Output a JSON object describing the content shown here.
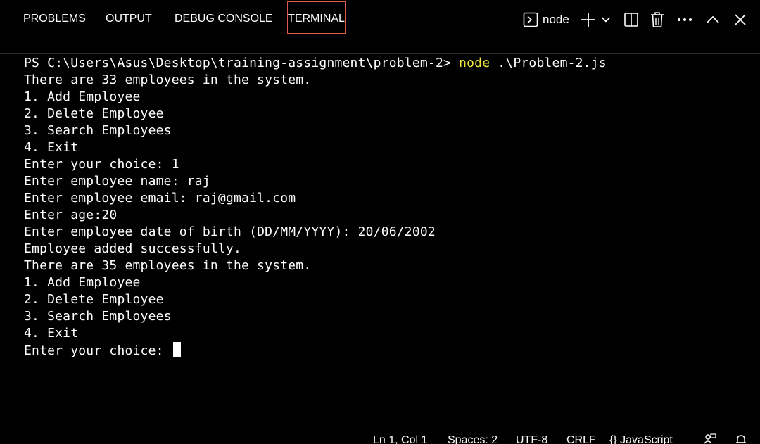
{
  "tabs": [
    {
      "label": "PROBLEMS"
    },
    {
      "label": "OUTPUT"
    },
    {
      "label": "DEBUG CONSOLE"
    },
    {
      "label": "TERMINAL"
    }
  ],
  "active_tab": "TERMINAL",
  "terminal_toolbar": {
    "terminal_name": "node",
    "icons": [
      "terminal-icon",
      "plus-icon",
      "chevron-down-icon",
      "split-icon",
      "trash-icon",
      "more-icon",
      "chevron-up-icon",
      "close-icon"
    ]
  },
  "terminal": {
    "prompt": "PS C:\\Users\\Asus\\Desktop\\training-assignment\\problem-2> ",
    "command": "node",
    "command_args": " .\\Problem-2.js",
    "lines": [
      "There are 33 employees in the system.",
      "1. Add Employee",
      "2. Delete Employee",
      "3. Search Employees",
      "4. Exit",
      "Enter your choice: 1",
      "Enter employee name: raj",
      "Enter employee email: raj@gmail.com",
      "Enter age:20",
      "Enter employee date of birth (DD/MM/YYYY): 20/06/2002",
      "Employee added successfully.",
      "There are 35 employees in the system.",
      "1. Add Employee",
      "2. Delete Employee",
      "3. Search Employees",
      "4. Exit"
    ],
    "current_input_prompt": "Enter your choice: "
  },
  "statusbar": {
    "position": "Ln 1, Col 1",
    "spaces": "Spaces: 2",
    "encoding": "UTF-8",
    "eol": "CRLF",
    "language": "JavaScript",
    "language_icon": "braces-icon",
    "icons": [
      "feedback-icon",
      "bell-icon"
    ]
  },
  "colors": {
    "background": "#000000",
    "text": "#ffffff",
    "command_highlight": "#f2e53c",
    "active_tab_border": "#e05a4a"
  }
}
